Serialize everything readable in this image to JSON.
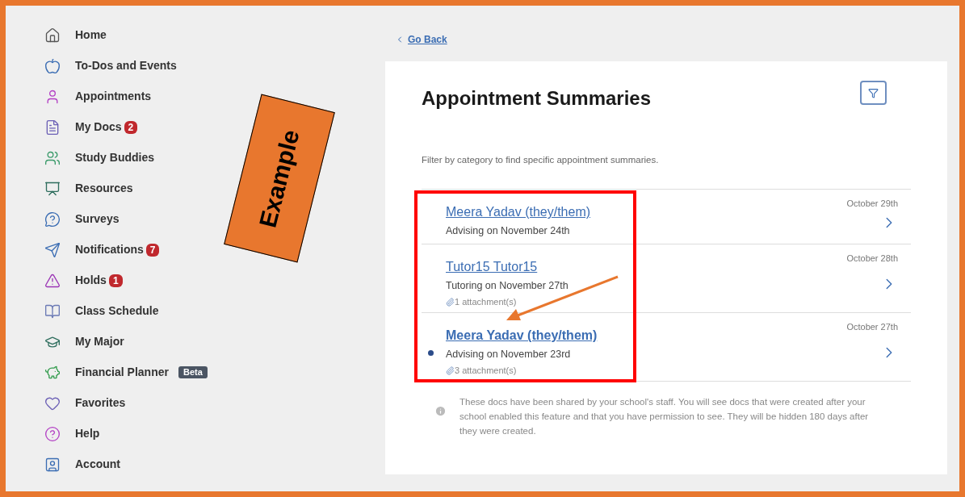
{
  "sidebar": {
    "items": [
      {
        "label": "Home"
      },
      {
        "label": "To-Dos and Events"
      },
      {
        "label": "Appointments"
      },
      {
        "label": "My Docs",
        "badge": "2"
      },
      {
        "label": "Study Buddies"
      },
      {
        "label": "Resources"
      },
      {
        "label": "Surveys"
      },
      {
        "label": "Notifications",
        "badge": "7"
      },
      {
        "label": "Holds",
        "badge": "1"
      },
      {
        "label": "Class Schedule"
      },
      {
        "label": "My Major"
      },
      {
        "label": "Financial Planner",
        "tag": "Beta"
      },
      {
        "label": "Favorites"
      },
      {
        "label": "Help"
      },
      {
        "label": "Account"
      }
    ]
  },
  "back_link": "Go Back",
  "page": {
    "title": "Appointment Summaries",
    "description": "Filter by category to find specific appointment summaries.",
    "rows": [
      {
        "name": "Meera Yadav (they/them)",
        "subtitle": "Advising on November 24th",
        "date": "October 29th",
        "unread": false
      },
      {
        "name": "Tutor15 Tutor15",
        "subtitle": "Tutoring on November 27th",
        "attachments": "1 attachment(s)",
        "date": "October 28th",
        "unread": false
      },
      {
        "name": "Meera Yadav (they/them)",
        "subtitle": "Advising on November 23rd",
        "attachments": "3 attachment(s)",
        "date": "October 27th",
        "unread": true
      }
    ],
    "note": "These docs have been shared by your school's staff. You will see docs that were created after your school enabled this feature and that you have permission to see. They will be hidden 180 days after they were created."
  },
  "annotation": {
    "sticker": "Example"
  }
}
